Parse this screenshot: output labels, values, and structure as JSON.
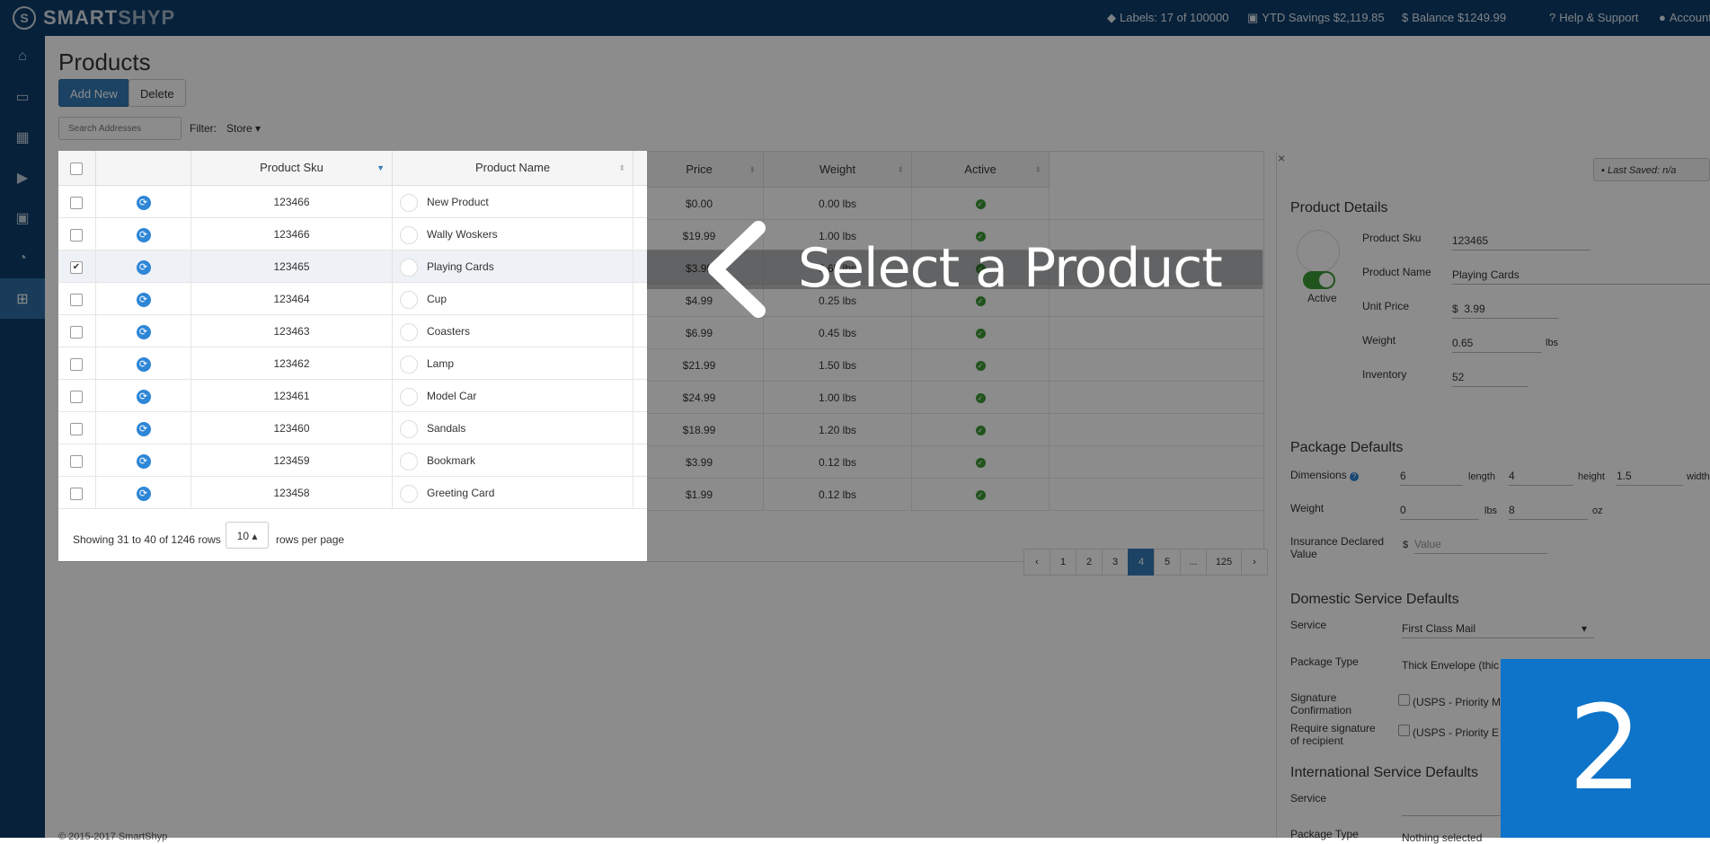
{
  "topbar": {
    "logo_mark": "S",
    "logo_smart": "SMART",
    "logo_shyp": "SHYP",
    "labels": "Labels: 17 of 100000",
    "ytd_savings": "YTD Savings $2,119.85",
    "balance": "Balance $1249.99",
    "help": "Help & Support",
    "account": "Account"
  },
  "sidebar": {
    "items": [
      {
        "icon": "home-icon",
        "glyph": "⌂"
      },
      {
        "icon": "basket-icon",
        "glyph": "▭"
      },
      {
        "icon": "calendar-icon",
        "glyph": "▦"
      },
      {
        "icon": "truck-icon",
        "glyph": "▶"
      },
      {
        "icon": "address-book-icon",
        "glyph": "▣"
      },
      {
        "icon": "pie-chart-icon",
        "glyph": "◔"
      },
      {
        "icon": "cart-icon",
        "glyph": "⊞"
      }
    ]
  },
  "page": {
    "title": "Products",
    "add_new": "Add New",
    "delete": "Delete",
    "search_placeholder": "Search Addresses",
    "filter_label": "Filter:",
    "filter_value": "Store ▾"
  },
  "table": {
    "columns": [
      "Product Sku",
      "Product Name",
      "Price",
      "Weight",
      "Active"
    ],
    "rows": [
      {
        "sku": "123466",
        "name": "New Product",
        "price": "$0.00",
        "weight": "0.00 lbs",
        "checked": false
      },
      {
        "sku": "123466",
        "name": "Wally Woskers",
        "price": "$19.99",
        "weight": "1.00 lbs",
        "checked": false
      },
      {
        "sku": "123465",
        "name": "Playing Cards",
        "price": "$3.99",
        "weight": "0.65 lbs",
        "checked": true
      },
      {
        "sku": "123464",
        "name": "Cup",
        "price": "$4.99",
        "weight": "0.25 lbs",
        "checked": false
      },
      {
        "sku": "123463",
        "name": "Coasters",
        "price": "$6.99",
        "weight": "0.45 lbs",
        "checked": false
      },
      {
        "sku": "123462",
        "name": "Lamp",
        "price": "$21.99",
        "weight": "1.50 lbs",
        "checked": false
      },
      {
        "sku": "123461",
        "name": "Model Car",
        "price": "$24.99",
        "weight": "1.00 lbs",
        "checked": false
      },
      {
        "sku": "123460",
        "name": "Sandals",
        "price": "$18.99",
        "weight": "1.20 lbs",
        "checked": false
      },
      {
        "sku": "123459",
        "name": "Bookmark",
        "price": "$3.99",
        "weight": "0.12 lbs",
        "checked": false
      },
      {
        "sku": "123458",
        "name": "Greeting Card",
        "price": "$1.99",
        "weight": "0.12 lbs",
        "checked": false
      }
    ],
    "showing": "Showing 31 to 40 of 1246 rows",
    "rows_per_page": "10 ▴",
    "rows_per_page_label": "rows per page",
    "pager": [
      "‹",
      "1",
      "2",
      "3",
      "4",
      "5",
      "...",
      "125",
      "›"
    ],
    "active_page": "4"
  },
  "detail": {
    "close": "×",
    "last_saved": "Last Saved: n/a",
    "product_details_title": "Product Details",
    "active_label": "Active",
    "sku_label": "Product Sku",
    "sku_value": "123465",
    "name_label": "Product Name",
    "name_value": "Playing Cards",
    "price_label": "Unit Price",
    "price_currency": "$",
    "price_value": "3.99",
    "weight_label": "Weight",
    "weight_value": "0.65",
    "weight_unit": "lbs",
    "inventory_label": "Inventory",
    "inventory_value": "52",
    "package_title": "Package Defaults",
    "dimensions_label": "Dimensions",
    "dim_length": "6",
    "dim_length_label": "length",
    "dim_height": "4",
    "dim_height_label": "height",
    "dim_width": "1.5",
    "dim_width_label": "width",
    "pkg_weight_label": "Weight",
    "pkg_weight_lbs": "0",
    "lbs": "lbs",
    "pkg_weight_oz": "8",
    "oz": "oz",
    "insurance_label_1": "Insurance Declared",
    "insurance_label_2": "Value",
    "insurance_currency": "$",
    "insurance_placeholder": "Value",
    "domestic_title": "Domestic Service Defaults",
    "service_label": "Service",
    "service_value": "First Class Mail",
    "package_type_label": "Package Type",
    "package_type_value": "Thick Envelope (thic",
    "sig_label_1": "Signature",
    "sig_label_2": "Confirmation",
    "sig_value": "(USPS - Priority M",
    "req_sig_label_1": "Require signature",
    "req_sig_label_2": "of recipient",
    "req_sig_value": "(USPS - Priority E",
    "international_title": "International Service Defaults",
    "intl_service_label": "Service",
    "intl_package_type_label": "Package Type",
    "intl_package_type_value": "Nothing selected"
  },
  "footer": {
    "copyright": "© 2015-2017 SmartShyp"
  },
  "overlay": {
    "title": "Select a Product",
    "step": "2"
  }
}
